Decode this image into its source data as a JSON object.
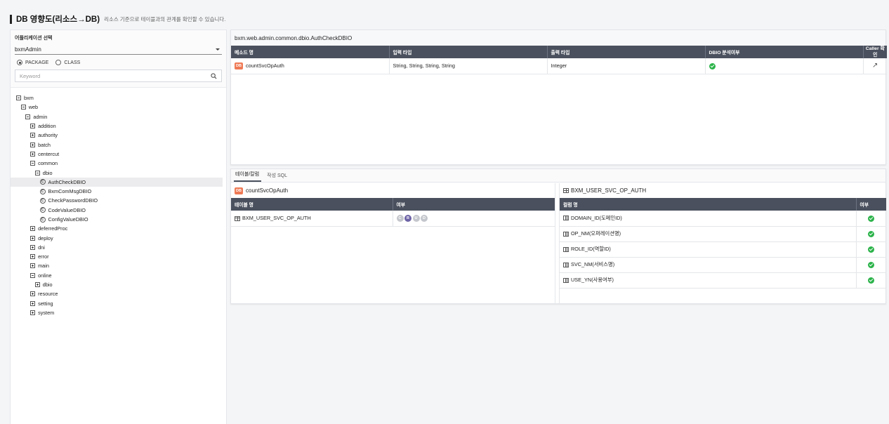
{
  "header": {
    "title": "DB 영향도(리소스→DB)",
    "description": "리소스 기준으로 테이블과의 관계를 확인할 수 있습니다."
  },
  "left": {
    "app_label": "어플리케이션 선택",
    "app_value": "bxmAdmin",
    "radio_package": "PACKAGE",
    "radio_class": "CLASS",
    "selected_radio": "PACKAGE",
    "search_placeholder": "Keyword",
    "tree": [
      {
        "label": "bxm",
        "level": 0,
        "type": "expanded"
      },
      {
        "label": "web",
        "level": 1,
        "type": "expanded"
      },
      {
        "label": "admin",
        "level": 2,
        "type": "expanded"
      },
      {
        "label": "addition",
        "level": 3,
        "type": "collapsed"
      },
      {
        "label": "authority",
        "level": 3,
        "type": "collapsed"
      },
      {
        "label": "batch",
        "level": 3,
        "type": "collapsed"
      },
      {
        "label": "centercut",
        "level": 3,
        "type": "collapsed"
      },
      {
        "label": "common",
        "level": 3,
        "type": "expanded"
      },
      {
        "label": "dbio",
        "level": 4,
        "type": "expanded"
      },
      {
        "label": "AuthCheckDBIO",
        "level": 5,
        "type": "class",
        "selected": true
      },
      {
        "label": "BxmComMsgDBIO",
        "level": 5,
        "type": "class"
      },
      {
        "label": "CheckPasswordDBIO",
        "level": 5,
        "type": "class"
      },
      {
        "label": "CodeValueDBIO",
        "level": 5,
        "type": "class"
      },
      {
        "label": "ConfigValueDBIO",
        "level": 5,
        "type": "class"
      },
      {
        "label": "deferredProc",
        "level": 3,
        "type": "collapsed"
      },
      {
        "label": "deploy",
        "level": 3,
        "type": "collapsed"
      },
      {
        "label": "dni",
        "level": 3,
        "type": "collapsed"
      },
      {
        "label": "error",
        "level": 3,
        "type": "collapsed"
      },
      {
        "label": "main",
        "level": 3,
        "type": "collapsed"
      },
      {
        "label": "online",
        "level": 3,
        "type": "expanded"
      },
      {
        "label": "dbio",
        "level": 4,
        "type": "collapsed"
      },
      {
        "label": "resource",
        "level": 3,
        "type": "collapsed"
      },
      {
        "label": "setting",
        "level": 3,
        "type": "collapsed"
      },
      {
        "label": "system",
        "level": 3,
        "type": "collapsed"
      }
    ]
  },
  "method_panel": {
    "title": "bxm.web.admin.common.dbio.AuthCheckDBIO",
    "columns": [
      "메소드 명",
      "입력 타입",
      "출력 타입",
      "DBIO 분석여부",
      "Caller 확인"
    ],
    "rows": [
      {
        "badge": "DB",
        "method": "countSvcOpAuth",
        "input": "String, String, String, String",
        "output": "Integer",
        "analyzed": true
      }
    ]
  },
  "tabs": {
    "items": [
      "테이블/칼럼",
      "작성 SQL"
    ],
    "active": 0
  },
  "table_panel": {
    "badge": "DB",
    "title": "countSvcOpAuth",
    "columns": [
      "테이블 명",
      "여부"
    ],
    "rows": [
      {
        "table": "BXM_USER_SVC_OP_AUTH",
        "crud": [
          "C",
          "R",
          "U",
          "D"
        ],
        "crud_active": [
          "R"
        ]
      }
    ]
  },
  "column_panel": {
    "title": "BXM_USER_SVC_OP_AUTH",
    "columns": [
      "컬럼 명",
      "여부"
    ],
    "rows": [
      {
        "column": "DOMAIN_ID(도메인ID)",
        "used": true
      },
      {
        "column": "OP_NM(오퍼레이션명)",
        "used": true
      },
      {
        "column": "ROLE_ID(역할ID)",
        "used": true
      },
      {
        "column": "SVC_NM(서비스명)",
        "used": true
      },
      {
        "column": "USE_YN(사용여부)",
        "used": true
      }
    ]
  }
}
